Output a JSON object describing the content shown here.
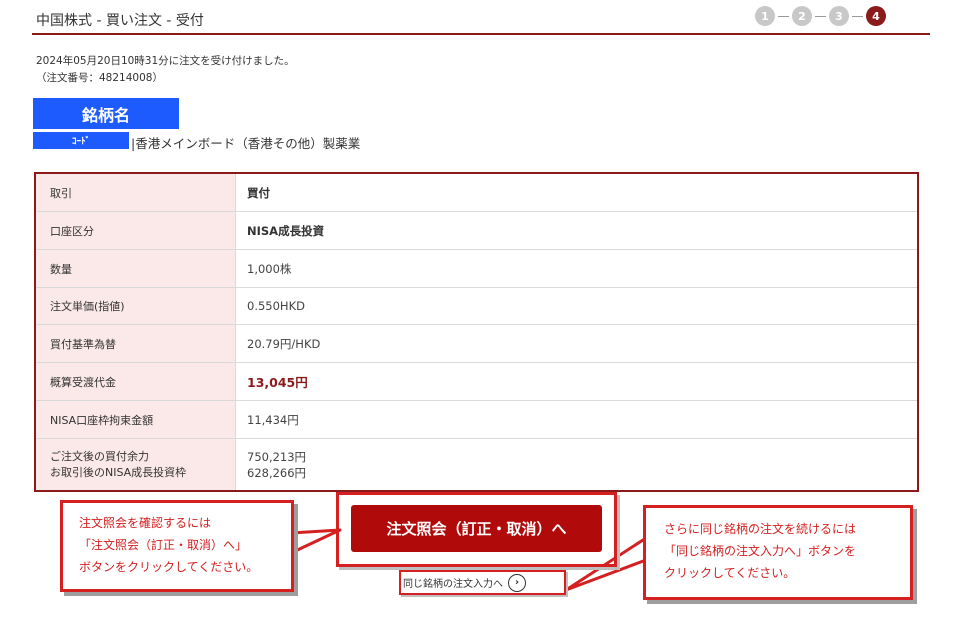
{
  "header": {
    "title": "中国株式 - 買い注文 - 受付",
    "steps": [
      "1",
      "2",
      "3",
      "4"
    ],
    "active_step": 4
  },
  "receipt": {
    "message": "2024年05月20日10時31分に注文を受け付けました。",
    "order_number": "（注文番号：48214008）"
  },
  "stock": {
    "name": "銘柄名",
    "code_label": "ｺｰﾄﾞ",
    "market_info": "|香港メインボード（香港その他）製薬業"
  },
  "order_details": [
    {
      "label": "取引",
      "value": "買付"
    },
    {
      "label": "口座区分",
      "value": "NISA成長投資"
    },
    {
      "label": "数量",
      "value": "1,000株"
    },
    {
      "label": "注文単価(指値)",
      "value": "0.550HKD"
    },
    {
      "label": "買付基準為替",
      "value": "20.79円/HKD"
    },
    {
      "label": "概算受渡代金",
      "value": "13,045円"
    },
    {
      "label": "NISA口座枠拘束金額",
      "value": "11,434円"
    },
    {
      "label": "ご注文後の買付余力",
      "label2": "お取引後のNISA成長投資枠",
      "value": "750,213円",
      "value2": "628,266円"
    }
  ],
  "actions": {
    "main_button": "注文照会（訂正・取消）へ",
    "same_stock_link": "同じ銘柄の注文入力へ",
    "arrow_glyph": "›"
  },
  "callouts": {
    "left": [
      "注文照会を確認するには",
      "「注文照会（訂正・取消）へ」",
      "ボタンをクリックしてください。"
    ],
    "right": [
      "さらに同じ銘柄の注文を続けるには",
      "「同じ銘柄の注文入力へ」ボタンを",
      "クリックしてください。"
    ]
  },
  "colors": {
    "accent": "#8b1a1a",
    "button": "#b10a0a",
    "callout": "#d42020",
    "stock_badge": "#1e5bff",
    "label_bg": "#fbe9e9"
  }
}
